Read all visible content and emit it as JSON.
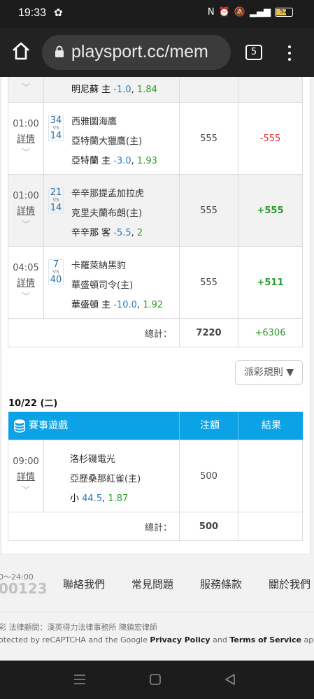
{
  "status": {
    "time": "19:33",
    "battery": "52",
    "network": "4G"
  },
  "browser": {
    "url": "playsport.cc/mem",
    "tab_count": "5"
  },
  "games_top": [
    {
      "time": "",
      "detail": "",
      "score_a": "",
      "score_b": "",
      "team_a": "",
      "team_b": "",
      "pick": "明尼蘇 主",
      "handicap": "-1.0",
      "odds": "1.84",
      "stake": "",
      "result": "",
      "result_color": "pos",
      "shaded": true
    },
    {
      "time": "01:00",
      "detail": "詳情",
      "score_a": "34",
      "score_b": "14",
      "team_a": "西雅圖海鷹",
      "team_b": "亞特蘭大獵鷹(主)",
      "pick": "亞特蘭 主",
      "handicap": "-3.0",
      "odds": "1.93",
      "stake": "555",
      "result": "-555",
      "result_color": "neg",
      "shaded": false
    },
    {
      "time": "01:00",
      "detail": "詳情",
      "score_a": "21",
      "score_b": "14",
      "team_a": "辛辛那提孟加拉虎",
      "team_b": "克里夫蘭布朗(主)",
      "pick": "辛辛那 客",
      "handicap": "-5.5",
      "odds": "2",
      "stake": "555",
      "result": "+555",
      "result_color": "pos",
      "shaded": true
    },
    {
      "time": "04:05",
      "detail": "詳情",
      "score_a": "7",
      "score_b": "40",
      "team_a": "卡羅萊納黑豹",
      "team_b": "華盛頓司令(主)",
      "pick": "華盛頓 主",
      "handicap": "-10.0",
      "odds": "1.92",
      "stake": "555",
      "result": "+511",
      "result_color": "pos",
      "shaded": false
    }
  ],
  "total_top": {
    "label": "總計：",
    "stake": "7220",
    "result": "+6306"
  },
  "rules_button": "派彩規則 ▼",
  "date2": "10/22 (二)",
  "header2": {
    "game": "賽事遊戲",
    "stake": "注額",
    "result": "結果"
  },
  "games_bottom": [
    {
      "time": "09:00",
      "detail": "詳情",
      "team_a": "洛杉磯電光",
      "team_b": "亞歷桑那紅雀(主)",
      "pick": "小",
      "handicap": "44.5",
      "odds": "1.87",
      "stake": "500",
      "result": ""
    }
  ],
  "total_bottom": {
    "label": "總計：",
    "stake": "500"
  },
  "footer": {
    "hours": "0～24:00",
    "phone": "00123",
    "links": [
      "聯絡我們",
      "常見問題",
      "服務條款",
      "關於我們"
    ],
    "legal": "彩 法律顧問：漢英得力法律事務所 陳鎮宏律師",
    "captcha_pre": "otected by reCAPTCHA and the Google ",
    "privacy": "Privacy Policy",
    "and": " and ",
    "terms": "Terms of Service",
    "apply": " apply."
  },
  "colors": {
    "header_blue": "#0ba3e6",
    "loss_red": "#d9383a",
    "win_green": "#2f9a2f",
    "handicap_blue": "#2a7bbf"
  }
}
